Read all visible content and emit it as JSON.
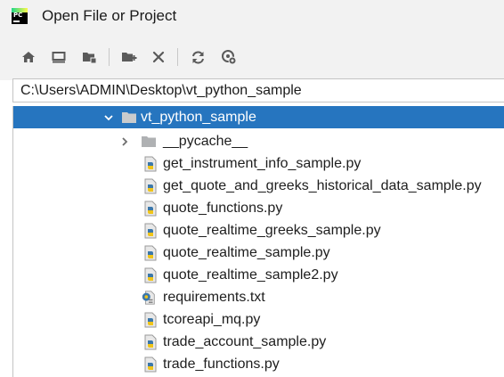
{
  "window": {
    "title": "Open File or Project",
    "app_icon": "pycharm-logo",
    "app_icon_text": "PC"
  },
  "toolbar": {
    "buttons": [
      {
        "name": "home-button",
        "icon": "home-icon",
        "tooltip": ""
      },
      {
        "name": "desktop-button",
        "icon": "desktop-icon"
      },
      {
        "name": "project-dir-button",
        "icon": "folder-project-icon"
      },
      {
        "name": "new-folder-button",
        "icon": "folder-add-icon"
      },
      {
        "name": "delete-button",
        "icon": "close-icon"
      },
      {
        "name": "refresh-button",
        "icon": "refresh-icon"
      },
      {
        "name": "show-hidden-button",
        "icon": "eye-toggle-icon"
      }
    ]
  },
  "path": {
    "value": "C:\\Users\\ADMIN\\Desktop\\vt_python_sample"
  },
  "tree": {
    "root": {
      "label": "vt_python_sample",
      "type": "folder",
      "expanded": true,
      "selected": true
    },
    "children": [
      {
        "label": "__pycache__",
        "type": "folder",
        "expanded": false
      },
      {
        "label": "get_instrument_info_sample.py",
        "type": "python"
      },
      {
        "label": "get_quote_and_greeks_historical_data_sample.py",
        "type": "python"
      },
      {
        "label": "quote_functions.py",
        "type": "python"
      },
      {
        "label": "quote_realtime_greeks_sample.py",
        "type": "python"
      },
      {
        "label": "quote_realtime_sample.py",
        "type": "python"
      },
      {
        "label": "quote_realtime_sample2.py",
        "type": "python"
      },
      {
        "label": "requirements.txt",
        "type": "requirements"
      },
      {
        "label": "tcoreapi_mq.py",
        "type": "python"
      },
      {
        "label": "trade_account_sample.py",
        "type": "python"
      },
      {
        "label": "trade_functions.py",
        "type": "python"
      }
    ]
  },
  "colors": {
    "selection": "#2675bf",
    "toolbar_bg": "#f2f2f2",
    "icon": "#5a5a5a",
    "folder": "#afb1b3"
  }
}
